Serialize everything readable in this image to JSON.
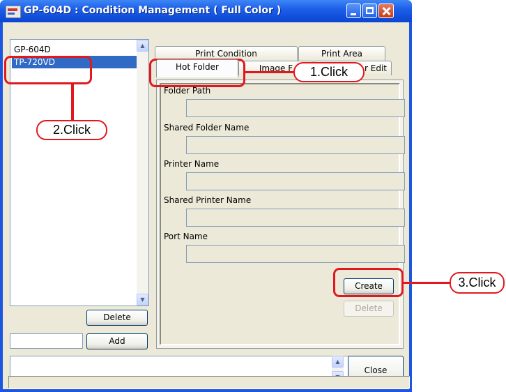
{
  "window": {
    "title": "GP-604D : Condition Management ( Full Color )"
  },
  "condition_list": {
    "items": [
      "GP-604D",
      "TP-720VD"
    ],
    "selected": "TP-720VD"
  },
  "left_buttons": {
    "delete_label": "Delete",
    "add_label": "Add"
  },
  "tabs": {
    "print_condition": "Print Condition",
    "print_area": "Print Area",
    "hot_folder": "Hot Folder",
    "image": "Image F",
    "user_edit": "r Edit",
    "active": "Hot Folder"
  },
  "hot_folder": {
    "fields": [
      {
        "label": "Folder Path",
        "value": ""
      },
      {
        "label": "Shared Folder Name",
        "value": ""
      },
      {
        "label": "Printer Name",
        "value": ""
      },
      {
        "label": "Shared Printer Name",
        "value": ""
      },
      {
        "label": "Port Name",
        "value": ""
      }
    ],
    "create_label": "Create",
    "delete_label": "Delete"
  },
  "footer": {
    "close_label": "Close"
  },
  "callouts": {
    "step1": "1.Click",
    "step2": "2.Click",
    "step3": "3.Click"
  },
  "colors": {
    "callout_red": "#e1191e",
    "selection_blue": "#316ac5",
    "titlebar_blue": "#1d5fe8"
  }
}
